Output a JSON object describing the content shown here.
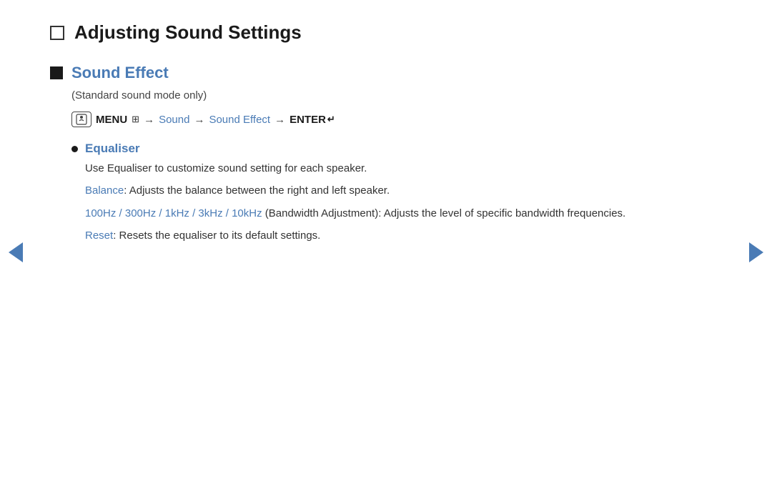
{
  "page": {
    "title": "Adjusting Sound Settings",
    "nav_left_label": "previous page",
    "nav_right_label": "next page"
  },
  "section": {
    "title": "Sound Effect",
    "subtitle": "(Standard sound mode only)",
    "menu_path": {
      "menu_icon_text": "m",
      "menu_label": "MENU",
      "menu_separator": "⊞",
      "arrow1": "→",
      "link1": "Sound",
      "arrow2": "→",
      "link2": "Sound Effect",
      "arrow3": "→",
      "enter_label": "ENTER",
      "enter_icon": "↵"
    },
    "bullet_items": [
      {
        "title": "Equaliser",
        "description": "Use Equaliser to customize sound setting for each speaker.",
        "details": [
          {
            "label": "Balance",
            "text": ": Adjusts the balance between the right and left speaker."
          },
          {
            "label": "100Hz / 300Hz / 1kHz / 3kHz / 10kHz",
            "text": " (Bandwidth Adjustment): Adjusts the level of specific bandwidth frequencies."
          },
          {
            "label": "Reset",
            "text": ": Resets the equaliser to its default settings."
          }
        ]
      }
    ]
  },
  "colors": {
    "blue": "#4a7bb5",
    "dark": "#1a1a1a"
  }
}
